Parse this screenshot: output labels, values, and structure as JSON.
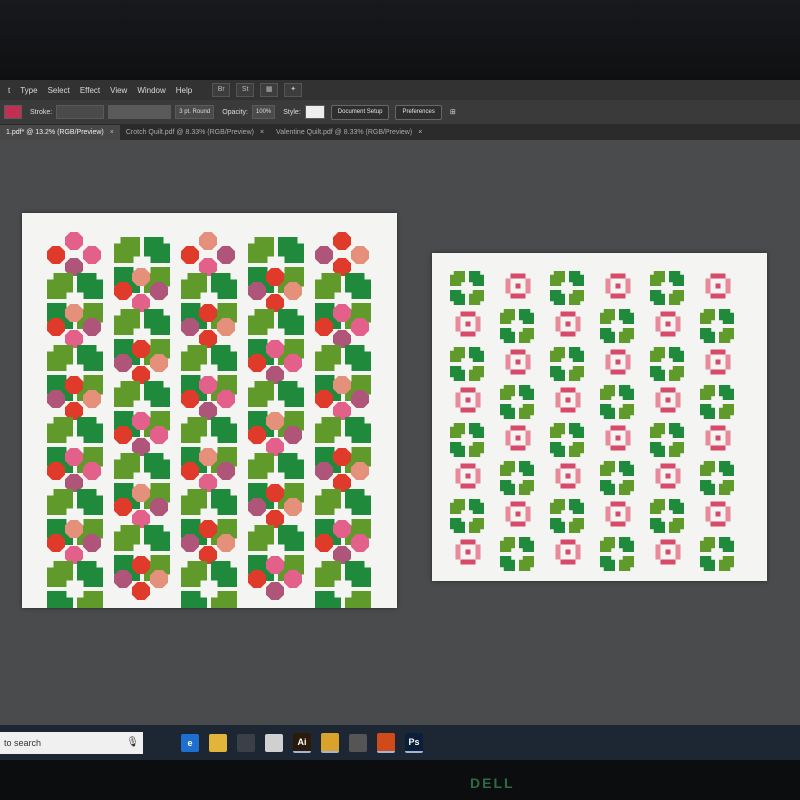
{
  "menubar": {
    "items": [
      "t",
      "Type",
      "Select",
      "Effect",
      "View",
      "Window",
      "Help"
    ],
    "icons": [
      "bridge-icon",
      "stock-icon",
      "arrange-documents-icon",
      "gpu-icon"
    ],
    "icon_labels": [
      "Br",
      "St",
      "",
      ""
    ]
  },
  "controlbar": {
    "stroke_label": "Stroke:",
    "stroke_weight": "3 pt. Round",
    "opacity_label": "Opacity:",
    "opacity_value": "100%",
    "style_label": "Style:",
    "document_setup_label": "Document Setup",
    "preferences_label": "Preferences"
  },
  "tabs": [
    {
      "title": "1.pdf* @ 13.2% (RGB/Preview)",
      "active": true
    },
    {
      "title": "Crotch Quilt.pdf @ 8.33% (RGB/Preview)",
      "active": false
    },
    {
      "title": "Valentine Quilt.pdf @ 8.33% (RGB/Preview)",
      "active": false
    }
  ],
  "taskbar": {
    "search_placeholder": "to search",
    "apps": [
      {
        "name": "task-view-icon",
        "label": "",
        "color": "#1d2633"
      },
      {
        "name": "edge-icon",
        "label": "e",
        "color": "#1e6fd0"
      },
      {
        "name": "file-explorer-icon",
        "label": "",
        "color": "#e0b53a"
      },
      {
        "name": "store-icon",
        "label": "",
        "color": "#3a3f48"
      },
      {
        "name": "mail-icon",
        "label": "",
        "color": "#d0d0d0"
      },
      {
        "name": "illustrator-icon",
        "label": "Ai",
        "color": "#2a1a0a"
      },
      {
        "name": "chrome-icon",
        "label": "",
        "color": "#d9a32b"
      },
      {
        "name": "app-icon",
        "label": "",
        "color": "#555555"
      },
      {
        "name": "monero-icon",
        "label": "",
        "color": "#d04a1a"
      },
      {
        "name": "photoshop-icon",
        "label": "Ps",
        "color": "#0b2038"
      }
    ]
  },
  "colors": {
    "holly_dark": "#1f8a3c",
    "holly_light": "#5f9a2a",
    "berry_red": "#e03a2a",
    "berry_pink": "#e2608a",
    "berry_plum": "#b0557a",
    "berry_salmon": "#e4907a",
    "petal_pink": "#e88a9a",
    "petal_rose": "#d84a6a"
  },
  "monitor": {
    "logo": "DELL"
  }
}
